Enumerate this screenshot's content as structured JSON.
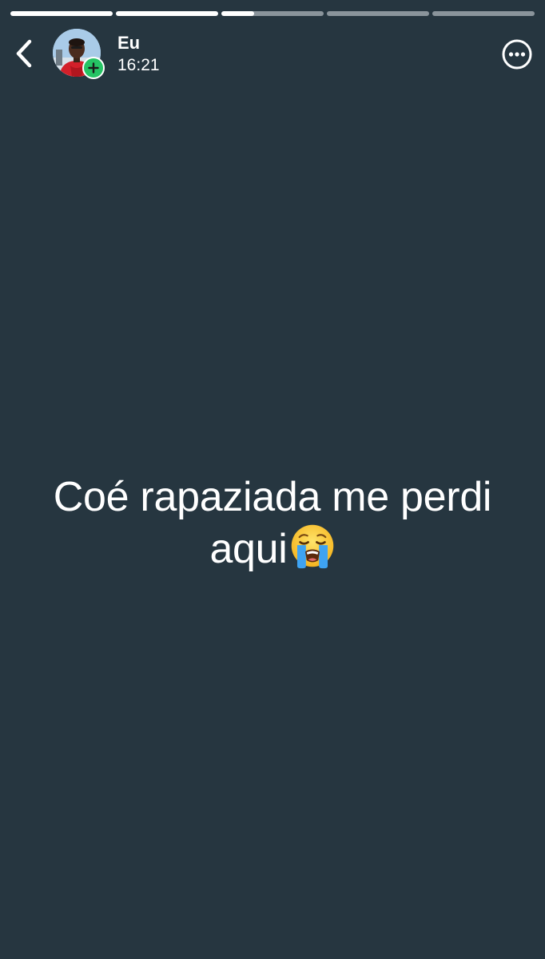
{
  "theme": {
    "background": "#263640",
    "progress_active": "#ffffff",
    "progress_inactive": "#8a949b",
    "badge_green": "#25c364"
  },
  "progress": {
    "segments": [
      1,
      1,
      0.32,
      0,
      0
    ]
  },
  "header": {
    "back_icon": "chevron-left-icon",
    "contact_name": "Eu",
    "timestamp": "16:21",
    "avatar_badge_icon": "plus-icon",
    "menu_icon": "more-horizontal-icon"
  },
  "status": {
    "text": "Coé rapaziada me perdi aqui",
    "emoji": "loudly-crying-face"
  }
}
